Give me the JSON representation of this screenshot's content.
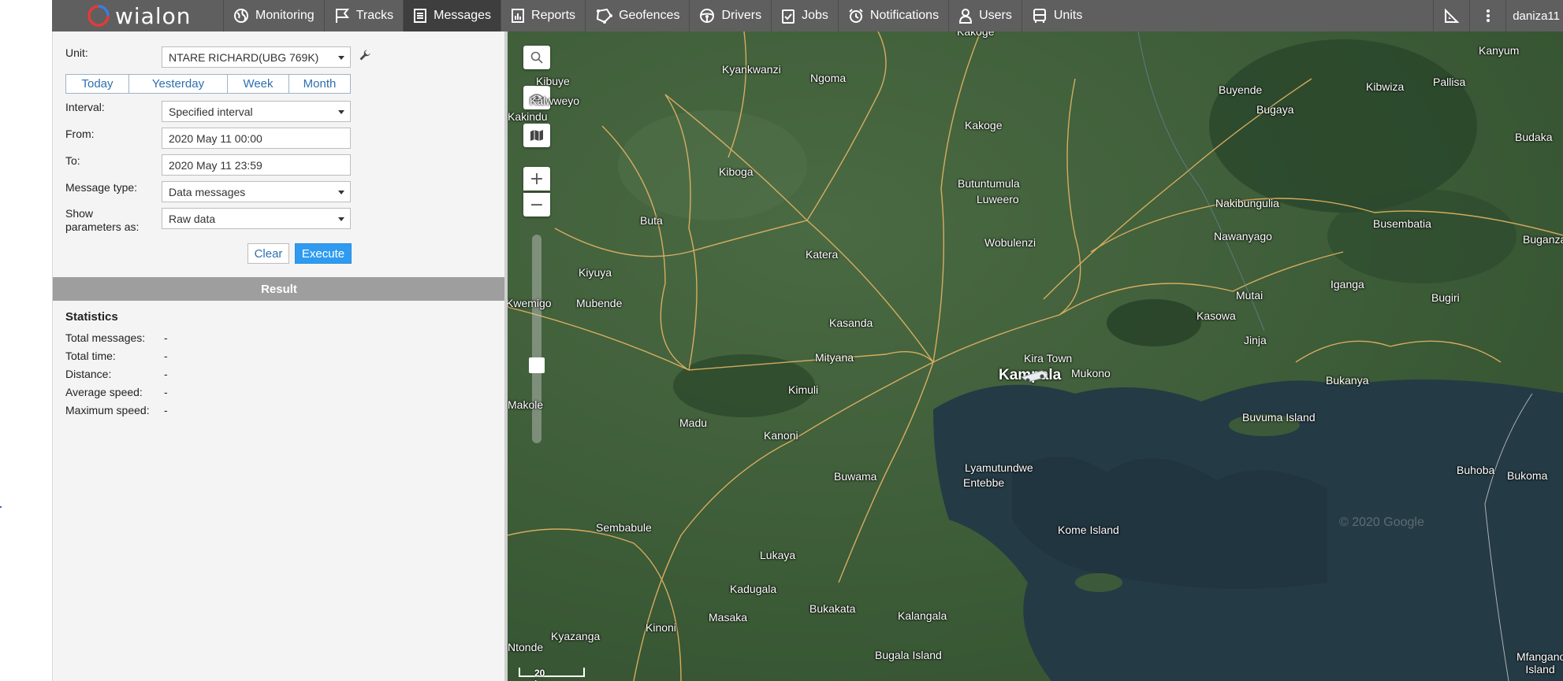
{
  "app": {
    "logo": "wialon",
    "user": "daniza11"
  },
  "nav": [
    {
      "label": "Monitoring",
      "icon": "globe-icon"
    },
    {
      "label": "Tracks",
      "icon": "flag-icon"
    },
    {
      "label": "Messages",
      "icon": "document-icon",
      "active": true
    },
    {
      "label": "Reports",
      "icon": "chart-icon"
    },
    {
      "label": "Geofences",
      "icon": "geofence-icon"
    },
    {
      "label": "Drivers",
      "icon": "steering-wheel-icon"
    },
    {
      "label": "Jobs",
      "icon": "checklist-icon"
    },
    {
      "label": "Notifications",
      "icon": "alarm-icon"
    },
    {
      "label": "Users",
      "icon": "user-icon"
    },
    {
      "label": "Units",
      "icon": "bus-icon"
    }
  ],
  "form": {
    "unit_label": "Unit:",
    "unit_value": "NTARE RICHARD(UBG 769K)",
    "periods": [
      "Today",
      "Yesterday",
      "Week",
      "Month"
    ],
    "interval_label": "Interval:",
    "interval_value": "Specified interval",
    "from_label": "From:",
    "from_value": "2020 May 11 00:00",
    "to_label": "To:",
    "to_value": "2020 May 11 23:59",
    "message_type_label": "Message type:",
    "message_type_value": "Data messages",
    "show_params_label_1": "Show",
    "show_params_label_2": "parameters as:",
    "show_params_value": "Raw data",
    "clear": "Clear",
    "execute": "Execute"
  },
  "result": {
    "header": "Result",
    "stats_title": "Statistics",
    "stats": [
      {
        "label": "Total messages:",
        "value": "-"
      },
      {
        "label": "Total time:",
        "value": "-"
      },
      {
        "label": "Distance:",
        "value": "-"
      },
      {
        "label": "Average speed:",
        "value": "-"
      },
      {
        "label": "Maximum speed:",
        "value": "-"
      }
    ]
  },
  "map": {
    "places": [
      "Kakoge",
      "Kanyum",
      "Kibuye",
      "Kyankwanzi",
      "Ngoma",
      "Kalwweyo",
      "Kakindu",
      "Buyende",
      "Kibwiza",
      "Pallisa",
      "Bugaya",
      "Kakoge",
      "Budaka",
      "Kiboga",
      "Butuntumula",
      "Luweero",
      "Nakibungulia",
      "Buta",
      "Busembatia",
      "Wobulenzi",
      "Nawanyago",
      "Buganza",
      "Katera",
      "Kiyuya",
      "Iganga",
      "Mubende",
      "Mutai",
      "Bugiri",
      "Kwemigo",
      "Kasanda",
      "Kasowa",
      "Jinja",
      "Mityana",
      "Kira Town",
      "Kampala",
      "Mukono",
      "Bukanya",
      "Kimuli",
      "Makole",
      "Buvuma Island",
      "Madu",
      "Kanoni",
      "Lyamutundwe",
      "Entebbe",
      "Buhoba",
      "Bukoma",
      "Buwama",
      "Kome Island",
      "Sembabule",
      "Lukaya",
      "Kadugala",
      "Bukakata",
      "Masaka",
      "Kalangala",
      "Kinoni",
      "Kyazanga",
      "Bugala Island",
      "Ntonde",
      "Mfangano Island"
    ],
    "copyright": "© 2020 Google",
    "scale": "20 km",
    "controls": [
      "search-icon",
      "eye-icon",
      "map-icon"
    ],
    "zoom_in": "+",
    "zoom_out": "−"
  }
}
